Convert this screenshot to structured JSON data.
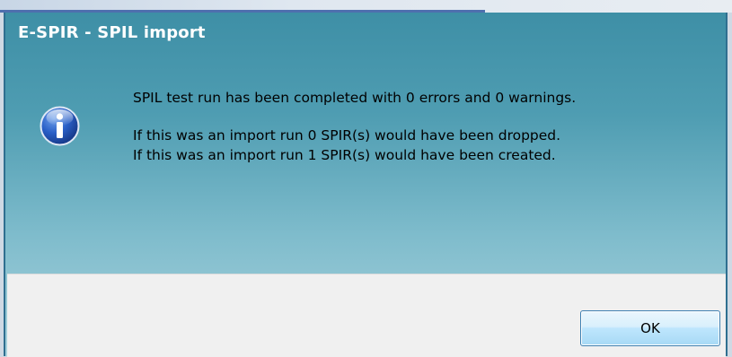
{
  "dialog": {
    "title": "E-SPIR - SPIL import",
    "icon": "info-icon",
    "message": {
      "line1": "SPIL test run has been completed with 0 errors and 0 warnings.",
      "line2": "If this was an import run 0 SPIR(s) would have been dropped.",
      "line3": "If this was an import run 1 SPIR(s) would have been created."
    },
    "ok_label": "OK"
  },
  "colors": {
    "title_bar_gradient_top": "#3e8fa6",
    "title_bar_gradient_bottom": "#a9d3dd",
    "footer_background": "#f0f0f0",
    "button_border": "#3c7fb1"
  }
}
